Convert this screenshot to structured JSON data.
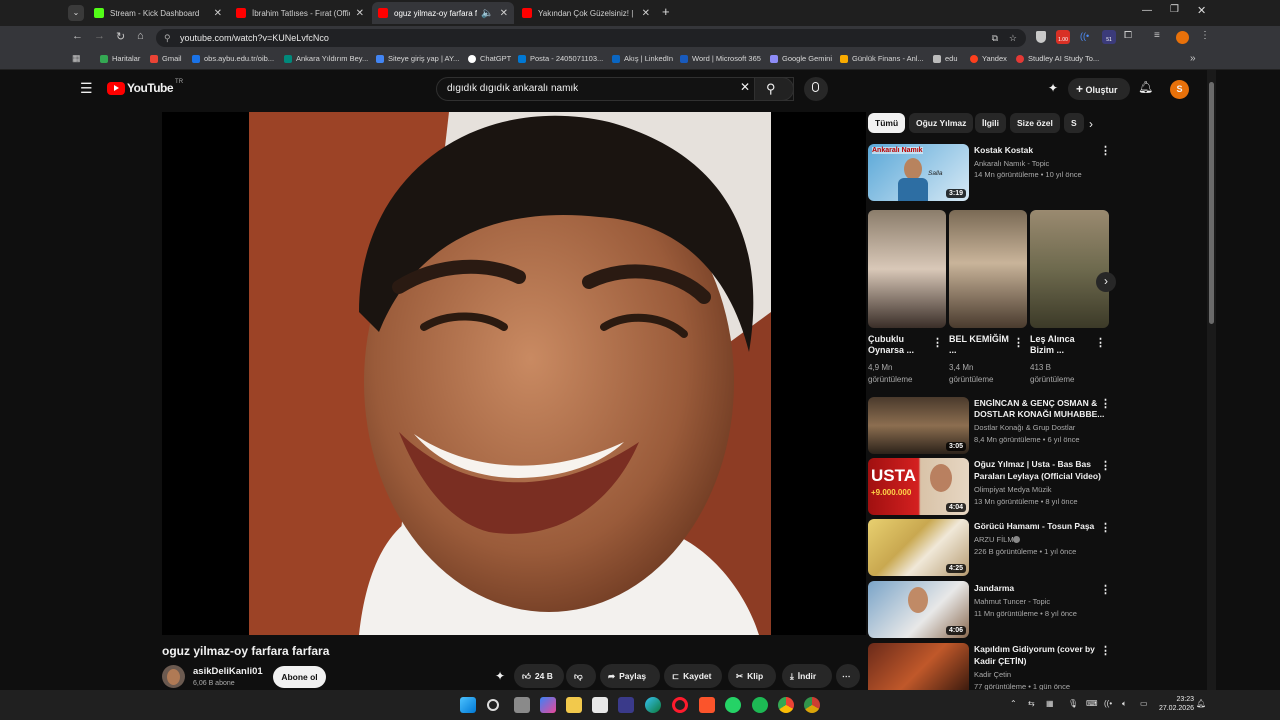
{
  "browser": {
    "tabs": [
      {
        "title": "Stream - Kick Dashboard",
        "favicon_color": "#53fc18"
      },
      {
        "title": "İbrahim Tatlıses - Fırat (Official",
        "favicon_color": "#ff0000"
      },
      {
        "title": "oguz yilmaz-oy farfara farfa",
        "favicon_color": "#ff0000",
        "active": true
      },
      {
        "title": "Yakından Çok Güzelsiniz! | Mar",
        "favicon_color": "#ff0000"
      }
    ],
    "new_tab": "+",
    "url": "youtube.com/watch?v=KUNeLvfcNco",
    "bookmarks": [
      {
        "label": "Haritalar",
        "color": "#34a853"
      },
      {
        "label": "Gmail",
        "color": "#ea4335"
      },
      {
        "label": "obs.aybu.edu.tr/oib...",
        "color": "#1a73e8"
      },
      {
        "label": "Ankara Yıldırım Bey...",
        "color": "#00897b"
      },
      {
        "label": "Siteye giriş yap | AY...",
        "color": "#4285f4"
      },
      {
        "label": "ChatGPT",
        "color": "#ffffff"
      },
      {
        "label": "Posta - 2405071103...",
        "color": "#0078d4"
      },
      {
        "label": "Akış | LinkedIn",
        "color": "#0a66c2"
      },
      {
        "label": "Word | Microsoft 365",
        "color": "#185abd"
      },
      {
        "label": "Google Gemini",
        "color": "#8e8cf7"
      },
      {
        "label": "Günlük Finans - Anl...",
        "color": "#f9ab00"
      },
      {
        "label": "edu",
        "color": "#bbbbbb"
      },
      {
        "label": "Yandex",
        "color": "#fc3f1d"
      },
      {
        "label": "Studley AI Study To...",
        "color": "#e53935"
      }
    ],
    "more_bookmarks": "»",
    "profile_badge": "1.00",
    "ext_badge": "51"
  },
  "youtube": {
    "logo_text": "YouTube",
    "region": "TR",
    "search_query": "dıgıdık dıgıdık ankaralı namık",
    "create_label": "Oluştur",
    "avatar_letter": "S",
    "video_title": "oguz yilmaz-oy farfara farfara",
    "channel_name": "asikDeliKanli01",
    "subscribers": "6,06 B abone",
    "subscribe_label": "Abone ol",
    "actions": {
      "likes": "24 B",
      "share": "Paylaş",
      "save": "Kaydet",
      "clip": "Klip",
      "download": "İndir"
    },
    "chips": [
      "Tümü",
      "Oğuz Yılmaz",
      "İlgili",
      "Size özel",
      "S"
    ],
    "shorts": [
      {
        "title": "Çubuklu Oynarsa ...",
        "views": "4,9 Mn",
        "views_label": "görüntüleme"
      },
      {
        "title": "BEL KEMİĞİM ...",
        "views": "3,4 Mn",
        "views_label": "görüntüleme"
      },
      {
        "title": "Leş Alınca Bizim ...",
        "views": "413 B",
        "views_label": "görüntüleme"
      }
    ],
    "recommendations": [
      {
        "title1": "Kostak Kostak",
        "title2": "",
        "channel": "Ankaralı Namık - Topic",
        "meta": "14 Mn görüntüleme • 10 yıl önce",
        "duration": "3:19",
        "thumb_text": "Ankaralı Namık",
        "thumb_sub": "Salla"
      },
      {
        "title1": "ENGİNCAN & GENÇ OSMAN &",
        "title2": "DOSTLAR KONAĞI MUHABBE...",
        "channel": "Dostlar Konağı & Grup Dostlar",
        "meta": "8,4 Mn görüntüleme • 6 yıl önce",
        "duration": "3:05",
        "thumb_text": "",
        "thumb_sub": ""
      },
      {
        "title1": "Oğuz Yılmaz | Usta - Bas Bas",
        "title2": "Paraları Leylaya (Official Video)",
        "channel": "Olimpiyat Medya Müzik",
        "meta": "13 Mn görüntüleme • 8 yıl önce",
        "duration": "4:04",
        "thumb_text": "USTA",
        "thumb_sub": "+9.000.000"
      },
      {
        "title1": "Görücü Hamamı - Tosun Paşa",
        "title2": "",
        "channel": "ARZU FİLM",
        "meta": "226 B görüntüleme • 1 yıl önce",
        "duration": "4:25",
        "thumb_text": "",
        "thumb_sub": ""
      },
      {
        "title1": "Jandarma",
        "title2": "",
        "channel": "Mahmut Tuncer - Topic",
        "meta": "11 Mn görüntüleme • 8 yıl önce",
        "duration": "4:06",
        "thumb_text": "",
        "thumb_sub": ""
      },
      {
        "title1": "Kapıldım Gidiyorum (cover by",
        "title2": "Kadir ÇETİN)",
        "channel": "Kadir Çetin",
        "meta": "77 görüntüleme • 1 gün önce",
        "duration": "",
        "thumb_text": "",
        "thumb_sub": ""
      }
    ]
  },
  "taskbar": {
    "time": "23:23",
    "date": "27.02.2026"
  }
}
